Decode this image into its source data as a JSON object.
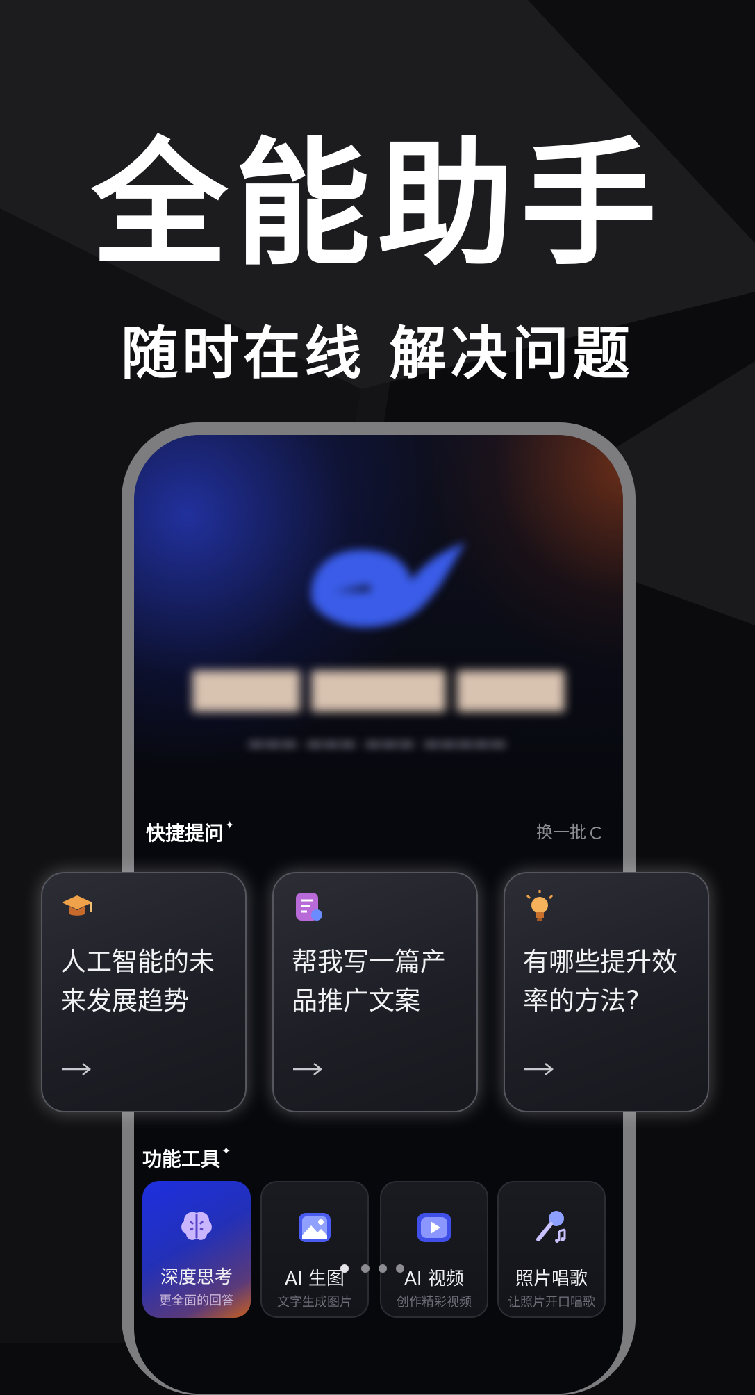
{
  "hero": {
    "title": "全能助手",
    "subtitle": "随时在线 解决问题"
  },
  "phone": {
    "app_logo_icon": "whale-logo-icon",
    "quick_questions": {
      "title": "快捷提问",
      "refresh_label": "换一批",
      "cards": [
        {
          "icon": "graduation-cap-icon",
          "text": "人工智能的未来发展趋势"
        },
        {
          "icon": "document-edit-icon",
          "text": "帮我写一篇产品推广文案"
        },
        {
          "icon": "lightbulb-icon",
          "text": "有哪些提升效率的方法?"
        }
      ]
    },
    "tools": {
      "title": "功能工具",
      "items": [
        {
          "name": "深度思考",
          "desc": "更全面的回答",
          "icon": "brain-icon",
          "active": true
        },
        {
          "name": "AI 生图",
          "desc": "文字生成图片",
          "icon": "image-icon",
          "active": false
        },
        {
          "name": "AI 视频",
          "desc": "创作精彩视频",
          "icon": "video-play-icon",
          "active": false
        },
        {
          "name": "照片唱歌",
          "desc": "让照片开口唱歌",
          "icon": "microphone-icon",
          "active": false
        }
      ]
    }
  },
  "colors": {
    "background": "#0b0b0d",
    "accent_blue": "#1e2fe0",
    "accent_orange": "#c8601e",
    "card_border": "#55565e"
  }
}
